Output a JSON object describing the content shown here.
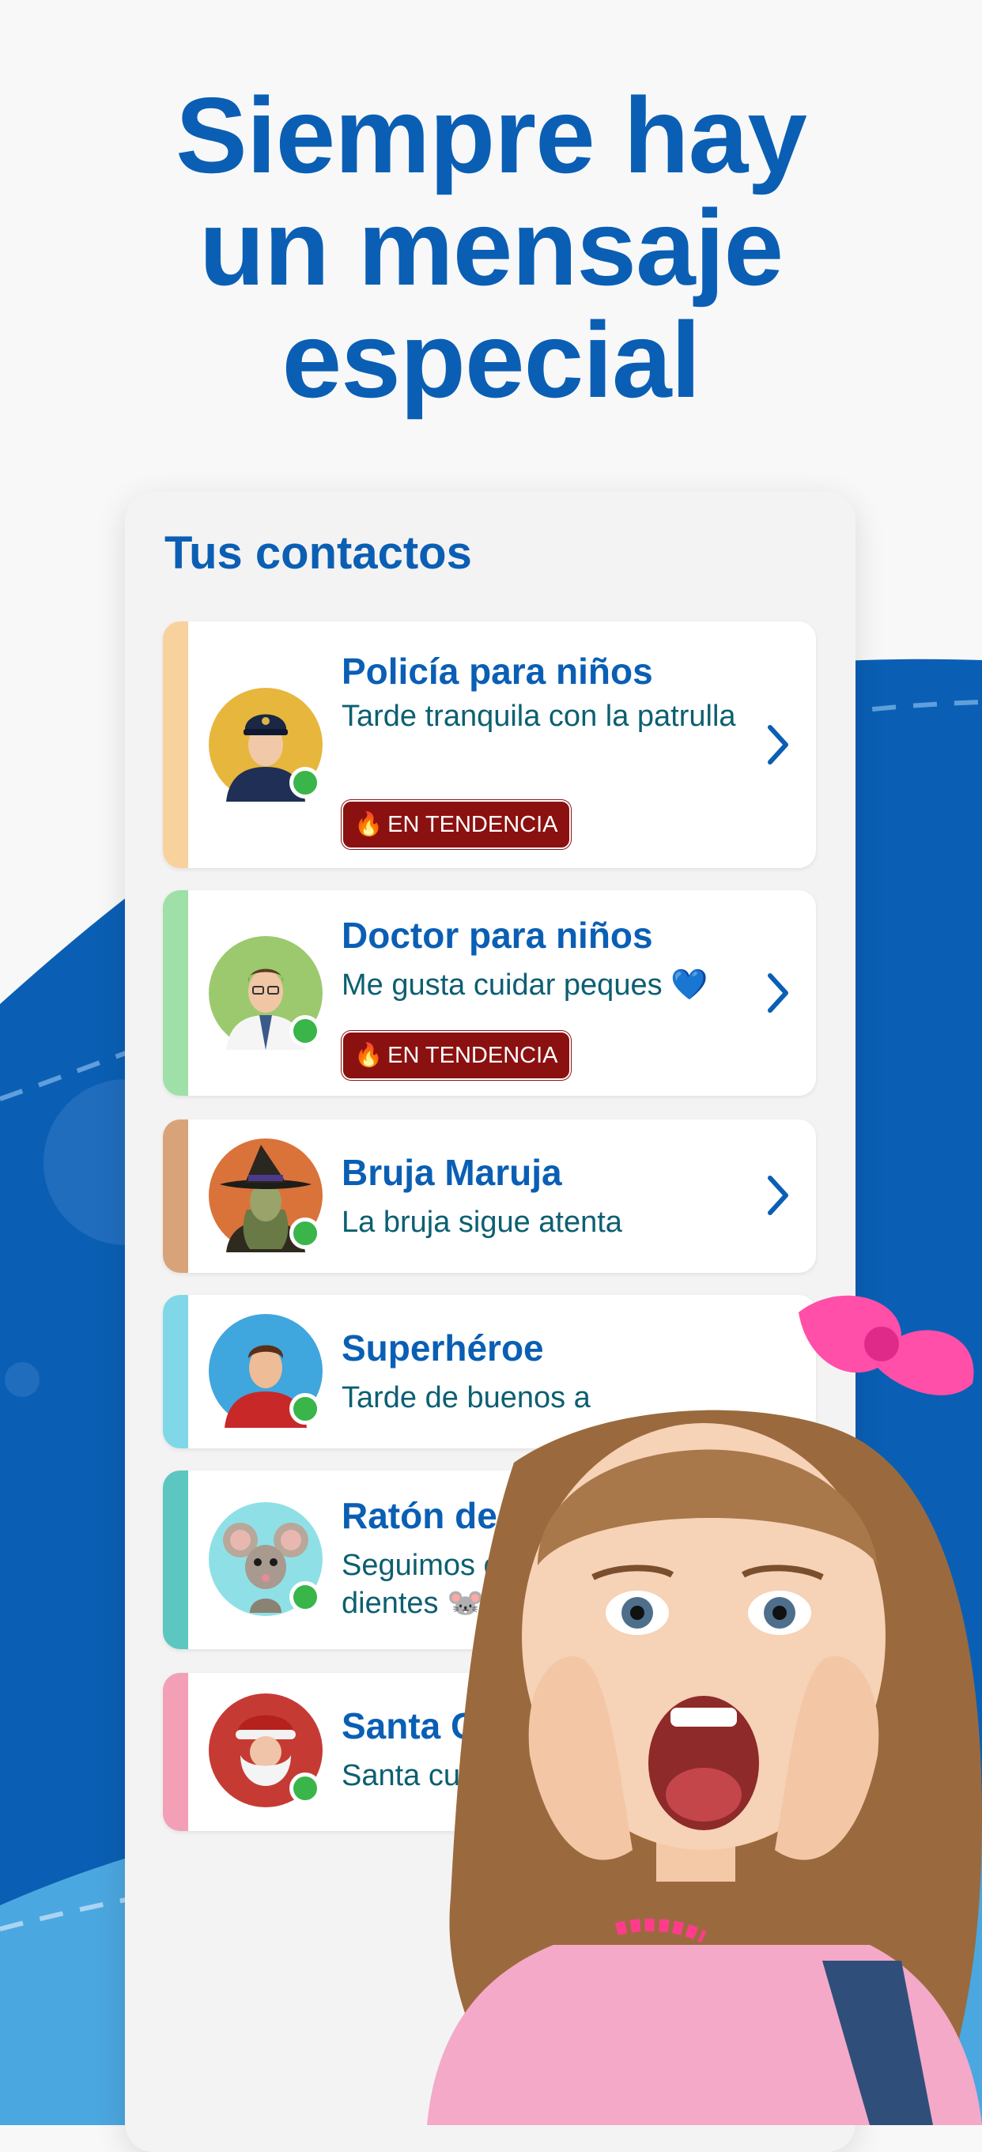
{
  "headline": {
    "line1": "Siempre hay",
    "line2": "un mensaje",
    "line3": "especial"
  },
  "card": {
    "title": "Tus contactos",
    "contacts": [
      {
        "name": "Policía para niños",
        "message": "Tarde tranquila con la patrulla",
        "badge": "EN TENDENCIA",
        "accent": "#f8d29c",
        "avatar": "police-officer-avatar"
      },
      {
        "name": "Doctor para niños",
        "message": "Me gusta cuidar peques 💙",
        "badge": "EN TENDENCIA",
        "accent": "#9fe0a8",
        "avatar": "doctor-avatar"
      },
      {
        "name": "Bruja Maruja",
        "message": "La bruja sigue atenta",
        "accent": "#d9a37a",
        "avatar": "witch-avatar"
      },
      {
        "name": "Superhéroe",
        "message": "Tarde de buenos a",
        "accent": "#7fd7e8",
        "avatar": "superhero-avatar"
      },
      {
        "name": "Ratón de lo",
        "message": "Seguimos cu dientes 🐭",
        "accent": "#5cc6c0",
        "avatar": "mouse-avatar"
      },
      {
        "name": "Santa Cla",
        "message": "Santa cuida",
        "accent": "#f3a0b6",
        "avatar": "santa-avatar"
      }
    ]
  },
  "colors": {
    "brand_blue": "#0a5fb4",
    "badge_red": "#8b1111",
    "online_green": "#39b54a",
    "wave_light_blue": "#4ba7e0"
  }
}
